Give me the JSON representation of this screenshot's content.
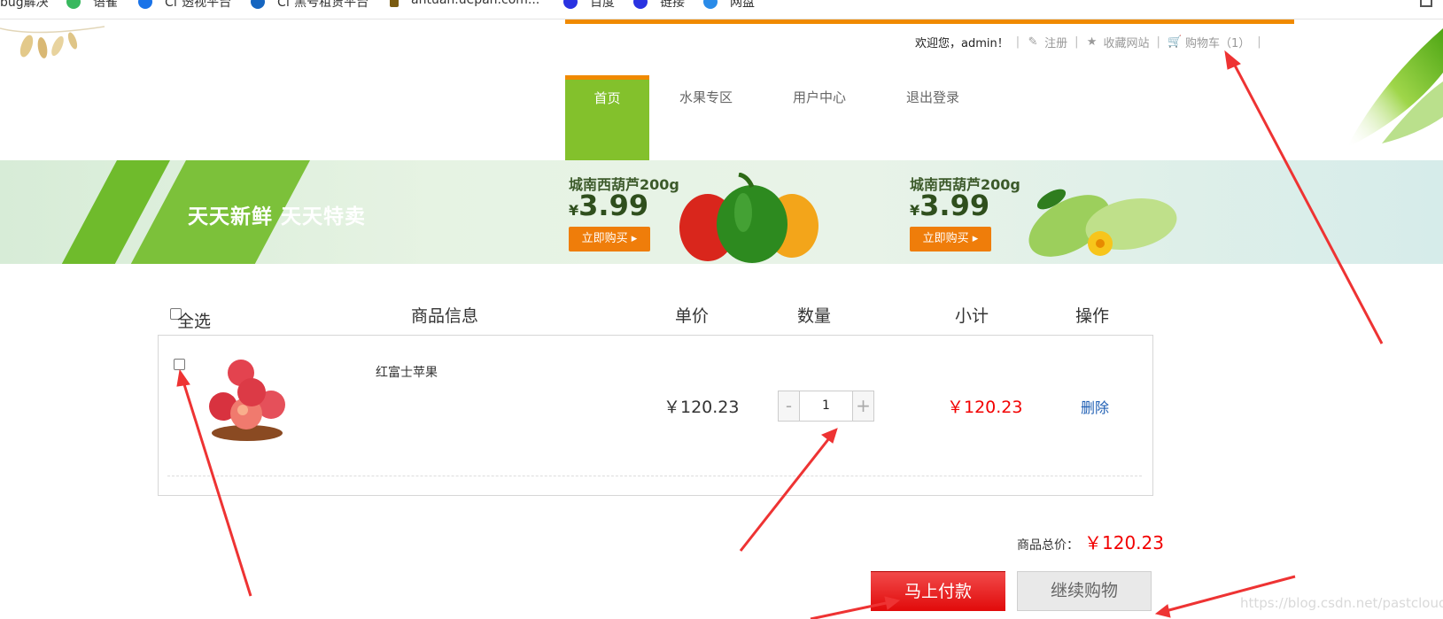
{
  "bookmarks": [
    {
      "label": "bug解决",
      "icon": "page-icon"
    },
    {
      "label": "语雀",
      "icon": "yuque-icon",
      "color": "#38b85e"
    },
    {
      "label": "Cf 透视平台",
      "icon": "cf-icon",
      "color": "#1a73e8"
    },
    {
      "label": "Cf 黑号租赁平台",
      "icon": "cf2-icon",
      "color": "#1565c0"
    },
    {
      "label": "antuan.uepan.com...",
      "icon": "tree-icon",
      "color": "#7a5b10"
    },
    {
      "label": "百度",
      "icon": "baidu-icon",
      "color": "#2932e1"
    },
    {
      "label": "链接",
      "icon": "baidu-icon",
      "color": "#2932e1"
    },
    {
      "label": "网盘",
      "icon": "cloud-icon",
      "color": "#2a8be8"
    }
  ],
  "header": {
    "welcome": "欢迎您，admin！",
    "register": "注册",
    "favorite": "收藏网站",
    "cart": "购物车（1）",
    "accent_color": "#f08a00"
  },
  "nav": {
    "items": [
      "首页",
      "水果专区",
      "用户中心",
      "退出登录"
    ],
    "active_color": "#83c12c"
  },
  "banner": {
    "slogan": "天天新鲜  天天特卖",
    "promos": [
      {
        "name": "城南西葫芦200g",
        "currency": "¥",
        "price": "3.99",
        "button": "立即购买 ▸"
      },
      {
        "name": "城南西葫芦200g",
        "currency": "¥",
        "price": "3.99",
        "button": "立即购买 ▸"
      }
    ]
  },
  "cart": {
    "headers": {
      "select_all": "全选",
      "info": "商品信息",
      "unit_price": "单价",
      "quantity": "数量",
      "subtotal": "小计",
      "actions": "操作"
    },
    "items": [
      {
        "name": "红富士苹果",
        "unit_price": "￥120.23",
        "quantity": "1",
        "minus": "-",
        "plus": "+",
        "subtotal": "￥120.23",
        "delete": "删除"
      }
    ],
    "total_label": "商品总价：",
    "total_value": "￥120.23",
    "pay_button": "马上付款",
    "continue_button": "继续购物",
    "price_color": "#f20000"
  },
  "watermark": "https://blog.csdn.net/pastclouds"
}
